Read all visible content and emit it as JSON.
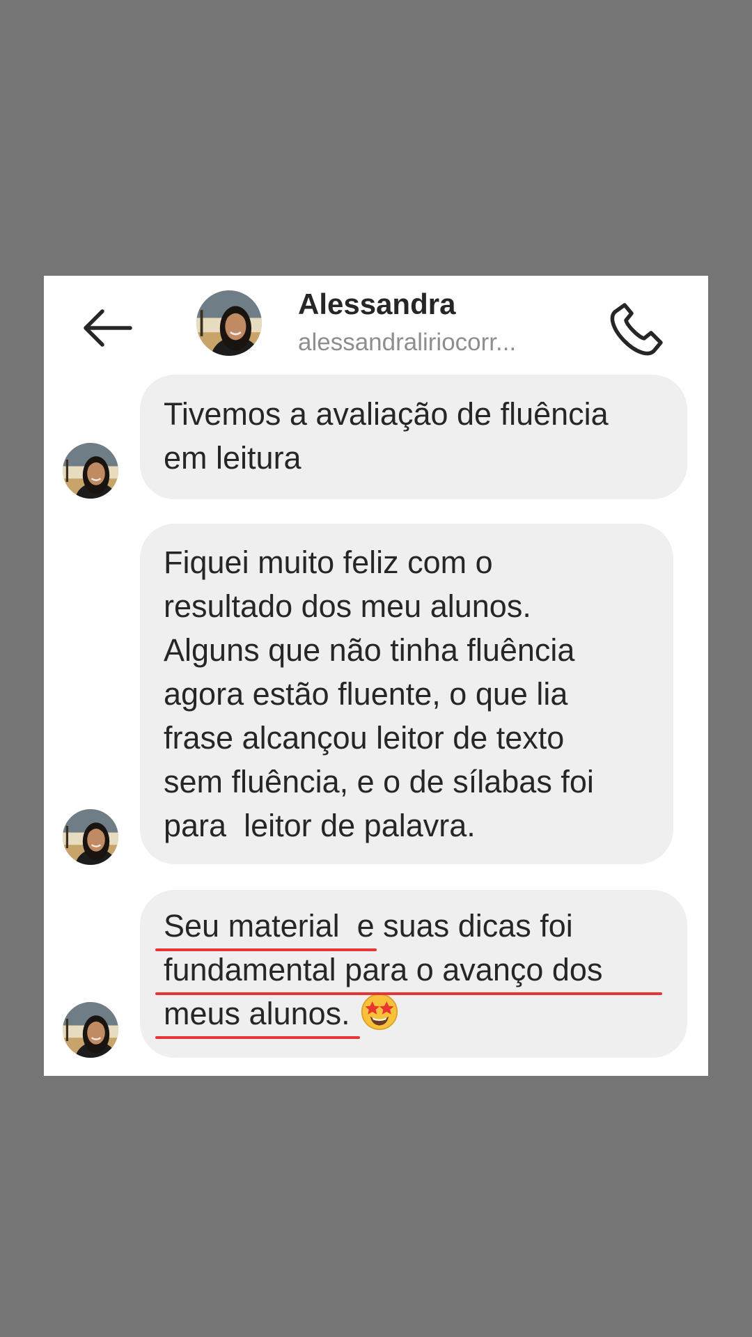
{
  "header": {
    "back_icon": "arrow-left-icon",
    "name": "Alessandra",
    "username": "alessandraliriocorr...",
    "call_icon": "phone-icon"
  },
  "messages": [
    {
      "lines": [
        "Tivemos a avaliação de fluência",
        "em leitura"
      ]
    },
    {
      "lines": [
        "Fiquei muito feliz com o",
        "resultado dos meu alunos.",
        "Alguns que não tinha fluência",
        "agora estão fluente, o que lia",
        "frase alcançou leitor de texto",
        "sem fluência, e o de sílabas foi",
        "para  leitor de palavra."
      ]
    },
    {
      "lines": [
        "Seu material  e suas dicas foi",
        "fundamental para o avanço dos",
        "meus alunos."
      ],
      "emoji": "star-struck-emoji"
    }
  ],
  "colors": {
    "background": "#767676",
    "card": "#ffffff",
    "bubble": "#efefef",
    "text": "#262626",
    "secondary_text": "#8e8e8e",
    "underline": "#e53535"
  }
}
